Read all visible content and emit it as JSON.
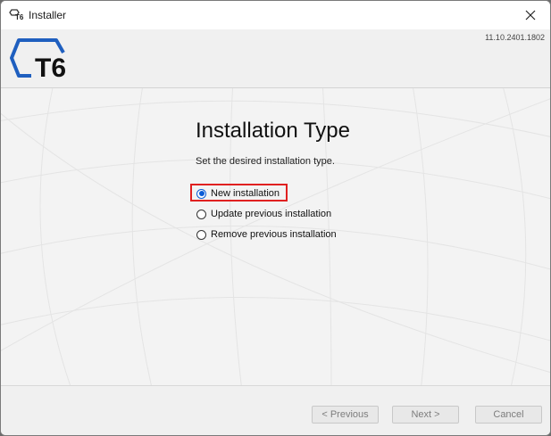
{
  "window": {
    "title": "Installer",
    "close_icon": "close-icon"
  },
  "header": {
    "logo_text": "T6",
    "version": "11.10.2401.1802",
    "brand_color": "#1f5fbf"
  },
  "page": {
    "heading": "Installation Type",
    "subtitle": "Set the desired installation type.",
    "options": [
      {
        "label": "New installation",
        "selected": true
      },
      {
        "label": "Update previous installation",
        "selected": false
      },
      {
        "label": "Remove previous installation",
        "selected": false
      }
    ]
  },
  "footer": {
    "previous_label": "< Previous",
    "next_label": "Next >",
    "cancel_label": "Cancel"
  },
  "colors": {
    "highlight": "#e02020",
    "radio_selected": "#0a5bd6"
  }
}
